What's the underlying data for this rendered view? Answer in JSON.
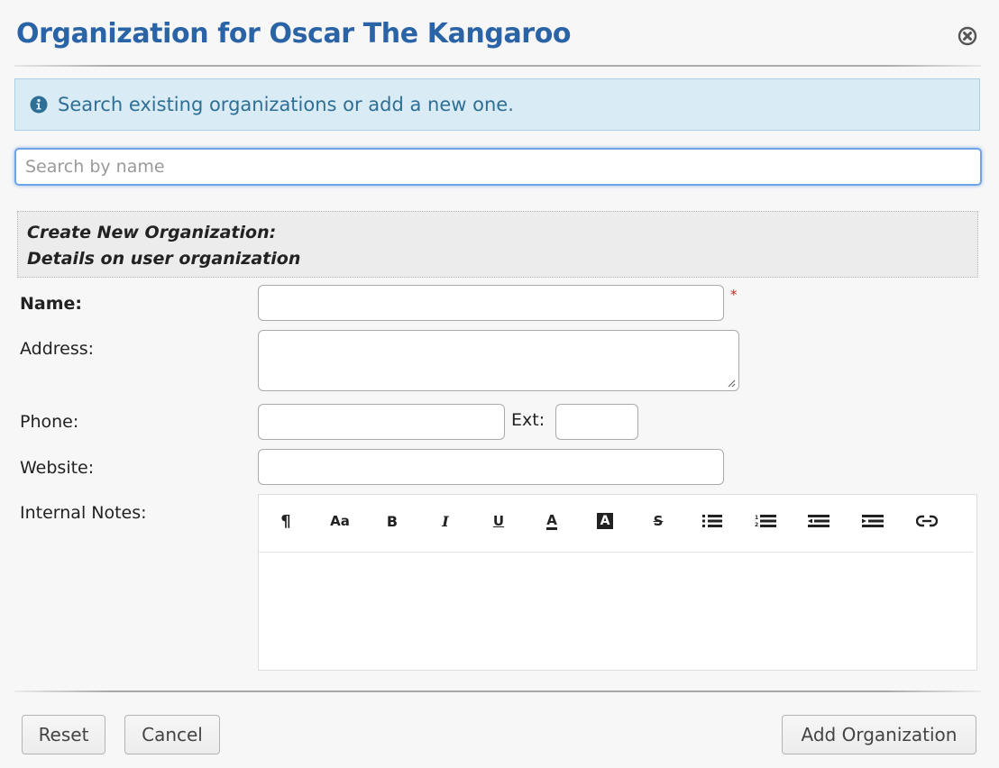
{
  "dialog": {
    "title": "Organization for Oscar The Kangaroo",
    "close_icon": "close-circle-icon"
  },
  "info": {
    "icon": "info-circle-icon",
    "text": "Search existing organizations or add a new one.",
    "colors": {
      "background": "#d9ecf6",
      "text": "#2f6f95"
    }
  },
  "search": {
    "placeholder": "Search by name",
    "value": ""
  },
  "section": {
    "line1": "Create New Organization:",
    "line2": "Details on user organization"
  },
  "form": {
    "name_label": "Name:",
    "name_value": "",
    "required_marker": "*",
    "address_label": "Address:",
    "address_value": "",
    "phone_label": "Phone:",
    "phone_value": "",
    "ext_label": "Ext:",
    "ext_value": "",
    "website_label": "Website:",
    "website_value": "",
    "notes_label": "Internal Notes:"
  },
  "editor_toolbar": [
    {
      "name": "paragraph",
      "icon": "paragraph-icon",
      "glyph": "¶"
    },
    {
      "name": "font-size",
      "icon": "font-size-icon",
      "glyph": "Aa"
    },
    {
      "name": "bold",
      "icon": "bold-icon",
      "glyph": "B"
    },
    {
      "name": "italic",
      "icon": "italic-icon",
      "glyph": "I"
    },
    {
      "name": "underline",
      "icon": "underline-icon",
      "glyph": "U"
    },
    {
      "name": "font-color",
      "icon": "font-color-icon",
      "glyph": "A"
    },
    {
      "name": "highlight",
      "icon": "highlight-icon",
      "glyph": "A"
    },
    {
      "name": "strikethrough",
      "icon": "strikethrough-icon",
      "glyph": "S"
    },
    {
      "name": "bulleted-list",
      "icon": "bulleted-list-icon",
      "glyph": ""
    },
    {
      "name": "numbered-list",
      "icon": "numbered-list-icon",
      "glyph": ""
    },
    {
      "name": "outdent",
      "icon": "outdent-icon",
      "glyph": ""
    },
    {
      "name": "indent",
      "icon": "indent-icon",
      "glyph": ""
    },
    {
      "name": "link",
      "icon": "link-icon",
      "glyph": ""
    }
  ],
  "buttons": {
    "reset": "Reset",
    "cancel": "Cancel",
    "add": "Add Organization"
  },
  "colors": {
    "title": "#2a64a6",
    "required": "#e0191f",
    "focus_border": "#6fa4e6"
  }
}
